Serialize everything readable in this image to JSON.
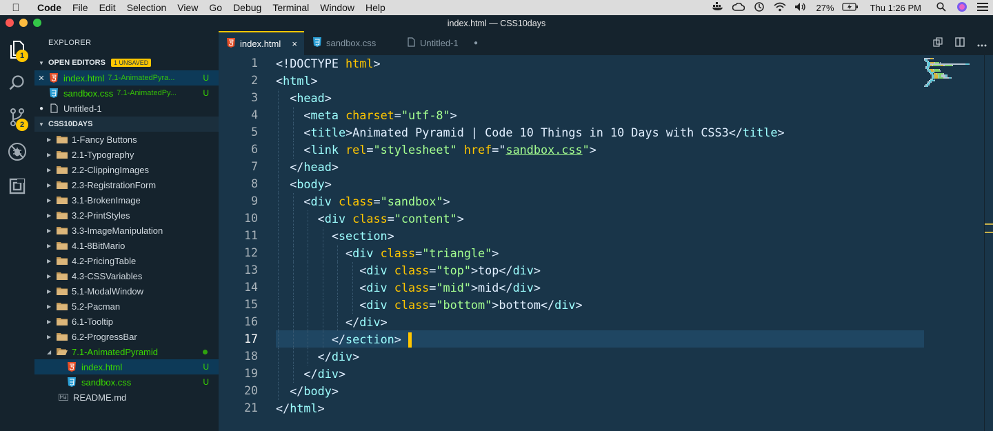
{
  "menubar": {
    "items": [
      "Code",
      "File",
      "Edit",
      "Selection",
      "View",
      "Go",
      "Debug",
      "Terminal",
      "Window",
      "Help"
    ],
    "battery": "27%",
    "clock": "Thu 1:26 PM"
  },
  "window": {
    "title": "index.html — CSS10days"
  },
  "activity": {
    "explorer_badge": "1",
    "scm_badge": "2"
  },
  "sidebar": {
    "title": "EXPLORER",
    "open_editors": {
      "header": "OPEN EDITORS",
      "unsaved_badge": "1 UNSAVED",
      "items": [
        {
          "name": "index.html",
          "path": "7.1-AnimatedPyra...",
          "status": "U"
        },
        {
          "name": "sandbox.css",
          "path": "7.1-AnimatedPy...",
          "status": "U"
        },
        {
          "name": "Untitled-1",
          "path": "",
          "status": ""
        }
      ]
    },
    "project": {
      "header": "CSS10DAYS",
      "folders": [
        "1-Fancy Buttons",
        "2.1-Typography",
        "2.2-ClippingImages",
        "2.3-RegistrationForm",
        "3.1-BrokenImage",
        "3.2-PrintStyles",
        "3.3-ImageManipulation",
        "4.1-8BitMario",
        "4.2-PricingTable",
        "4.3-CSSVariables",
        "5.1-ModalWindow",
        "5.2-Pacman",
        "6.1-Tooltip",
        "6.2-ProgressBar"
      ],
      "open_folder": "7.1-AnimatedPyramid",
      "open_folder_files": [
        {
          "name": "index.html",
          "status": "U"
        },
        {
          "name": "sandbox.css",
          "status": "U"
        }
      ],
      "readme": "README.md"
    }
  },
  "tabs": [
    {
      "label": "index.html",
      "close": "×"
    },
    {
      "label": "sandbox.css",
      "close": ""
    },
    {
      "label": "Untitled-1",
      "close": "●"
    }
  ],
  "editor": {
    "current_line": 17,
    "line_numbers": [
      "1",
      "2",
      "3",
      "4",
      "5",
      "6",
      "7",
      "8",
      "9",
      "10",
      "11",
      "12",
      "13",
      "14",
      "15",
      "16",
      "17",
      "18",
      "19",
      "20",
      "21"
    ],
    "lines": [
      [
        [
          "p",
          "<!DOCTYPE "
        ],
        [
          "a",
          "html"
        ],
        [
          "p",
          ">"
        ]
      ],
      [
        [
          "p",
          "<"
        ],
        [
          "t",
          "html"
        ],
        [
          "p",
          ">"
        ]
      ],
      [
        [
          "p",
          "  <"
        ],
        [
          "t",
          "head"
        ],
        [
          "p",
          ">"
        ]
      ],
      [
        [
          "p",
          "    <"
        ],
        [
          "t",
          "meta "
        ],
        [
          "a",
          "charset"
        ],
        [
          "p",
          "="
        ],
        [
          "s",
          "\"utf-8\""
        ],
        [
          "p",
          ">"
        ]
      ],
      [
        [
          "p",
          "    <"
        ],
        [
          "t",
          "title"
        ],
        [
          "p",
          ">Animated Pyramid | Code 10 Things in 10 Days with CSS3</"
        ],
        [
          "t",
          "title"
        ],
        [
          "p",
          ">"
        ]
      ],
      [
        [
          "p",
          "    <"
        ],
        [
          "t",
          "link "
        ],
        [
          "a",
          "rel"
        ],
        [
          "p",
          "="
        ],
        [
          "s",
          "\"stylesheet\" "
        ],
        [
          "a",
          "href"
        ],
        [
          "p",
          "=\""
        ],
        [
          "su",
          "sandbox.css"
        ],
        [
          "s",
          "\""
        ],
        [
          "p",
          ">"
        ]
      ],
      [
        [
          "p",
          "  </"
        ],
        [
          "t",
          "head"
        ],
        [
          "p",
          ">"
        ]
      ],
      [
        [
          "p",
          "  <"
        ],
        [
          "t",
          "body"
        ],
        [
          "p",
          ">"
        ]
      ],
      [
        [
          "p",
          "    <"
        ],
        [
          "t",
          "div "
        ],
        [
          "a",
          "class"
        ],
        [
          "p",
          "="
        ],
        [
          "s",
          "\"sandbox\""
        ],
        [
          "p",
          ">"
        ]
      ],
      [
        [
          "p",
          "      <"
        ],
        [
          "t",
          "div "
        ],
        [
          "a",
          "class"
        ],
        [
          "p",
          "="
        ],
        [
          "s",
          "\"content\""
        ],
        [
          "p",
          ">"
        ]
      ],
      [
        [
          "p",
          "        <"
        ],
        [
          "t",
          "section"
        ],
        [
          "p",
          ">"
        ]
      ],
      [
        [
          "p",
          "          <"
        ],
        [
          "t",
          "div "
        ],
        [
          "a",
          "class"
        ],
        [
          "p",
          "="
        ],
        [
          "s",
          "\"triangle\""
        ],
        [
          "p",
          ">"
        ]
      ],
      [
        [
          "p",
          "            <"
        ],
        [
          "t",
          "div "
        ],
        [
          "a",
          "class"
        ],
        [
          "p",
          "="
        ],
        [
          "s",
          "\"top\""
        ],
        [
          "p",
          ">top</"
        ],
        [
          "t",
          "div"
        ],
        [
          "p",
          ">"
        ]
      ],
      [
        [
          "p",
          "            <"
        ],
        [
          "t",
          "div "
        ],
        [
          "a",
          "class"
        ],
        [
          "p",
          "="
        ],
        [
          "s",
          "\"mid\""
        ],
        [
          "p",
          ">mid</"
        ],
        [
          "t",
          "div"
        ],
        [
          "p",
          ">"
        ]
      ],
      [
        [
          "p",
          "            <"
        ],
        [
          "t",
          "div "
        ],
        [
          "a",
          "class"
        ],
        [
          "p",
          "="
        ],
        [
          "s",
          "\"bottom\""
        ],
        [
          "p",
          ">bottom</"
        ],
        [
          "t",
          "div"
        ],
        [
          "p",
          ">"
        ]
      ],
      [
        [
          "p",
          "          </"
        ],
        [
          "t",
          "div"
        ],
        [
          "p",
          ">"
        ]
      ],
      [
        [
          "p",
          "        </"
        ],
        [
          "t",
          "section"
        ],
        [
          "p",
          ">"
        ]
      ],
      [
        [
          "p",
          "      </"
        ],
        [
          "t",
          "div"
        ],
        [
          "p",
          ">"
        ]
      ],
      [
        [
          "p",
          "    </"
        ],
        [
          "t",
          "div"
        ],
        [
          "p",
          ">"
        ]
      ],
      [
        [
          "p",
          "  </"
        ],
        [
          "t",
          "body"
        ],
        [
          "p",
          ">"
        ]
      ],
      [
        [
          "p",
          "</"
        ],
        [
          "t",
          "html"
        ],
        [
          "p",
          ">"
        ]
      ]
    ]
  },
  "colors": {
    "editor_bg": "#193549",
    "sidebar_bg": "#15232d",
    "accent": "#ffc600",
    "tag": "#9effff",
    "attribute": "#ffc600",
    "string": "#a5ff90",
    "git_untracked": "#3ad900"
  }
}
